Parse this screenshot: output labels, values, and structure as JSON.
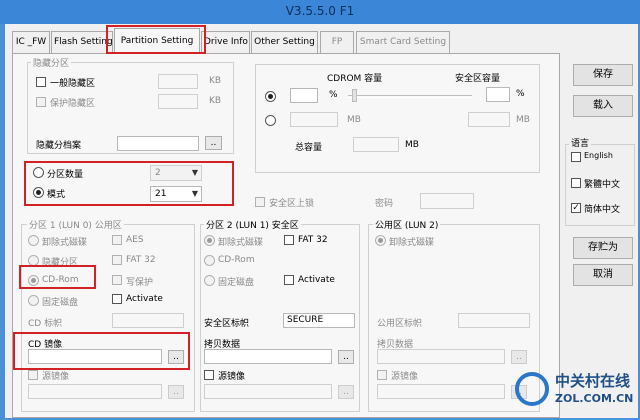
{
  "window": {
    "title": "V3.5.5.0 F1"
  },
  "tabs": [
    {
      "label": "IC _FW"
    },
    {
      "label": "Flash Setting"
    },
    {
      "label": "Partition Setting"
    },
    {
      "label": "Drive Info"
    },
    {
      "label": "Other Setting"
    },
    {
      "label": "FP"
    },
    {
      "label": "Smart Card Setting"
    }
  ],
  "hidden_partition": {
    "group_label": "隐藏分区",
    "general_label": "一般隐藏区",
    "protect_label": "保护隐藏区",
    "unit1": "KB",
    "unit2": "KB",
    "file_label": "隐藏分档案",
    "browse": ".."
  },
  "cdrom_area": {
    "cdrom_capacity_label": "CDROM 容量",
    "secure_capacity_label": "安全区容量",
    "percent1": "%",
    "percent2": "%",
    "mb1": "MB",
    "mb2": "MB",
    "total_label": "总容量",
    "total_unit": "MB"
  },
  "partition_mode": {
    "count_label": "分区数量",
    "count_value": "2",
    "mode_label": "模式",
    "mode_value": "21"
  },
  "secure_lock": {
    "label": "安全区上锁",
    "password_label": "密码"
  },
  "p1": {
    "group_label": "分区 1 (LUN 0) 公用区",
    "removable": "卸除式磁碟",
    "hidden": "隐藏分区",
    "cdrom": "CD-Rom",
    "fixed": "固定磁盘",
    "aes": "AES",
    "fat32": "FAT 32",
    "write_protect": "写保护",
    "activate": "Activate",
    "cd_label_label": "CD 标帜",
    "cd_image_label": "CD 镜像",
    "browse1": "..",
    "source_image": "源镜像",
    "browse2": ".."
  },
  "p2": {
    "group_label": "分区 2 (LUN 1) 安全区",
    "removable": "卸除式磁碟",
    "cdrom": "CD-Rom",
    "fixed": "固定磁盘",
    "fat32": "FAT 32",
    "activate": "Activate",
    "secure_label_label": "安全区标帜",
    "secure_label_value": "SECURE",
    "copy_data_label": "拷贝数据",
    "browse1": "..",
    "source_image": "源镜像",
    "browse2": ".."
  },
  "public_area": {
    "group_label": "公用区 (LUN 2)",
    "removable": "卸除式磁碟",
    "label_label": "公用区标帜",
    "copy_data_label": "拷贝数据",
    "browse1": "..",
    "source_image": "源镜像",
    "browse2": ".."
  },
  "side": {
    "save": "保存",
    "load": "载入",
    "language_label": "语言",
    "english": "English",
    "trad_chinese": "繁體中文",
    "simp_chinese": "简体中文",
    "save_as": "存贮为",
    "cancel": "取消"
  },
  "watermark": {
    "text": "中关村在线",
    "sub": "ZOL.COM.CN"
  }
}
